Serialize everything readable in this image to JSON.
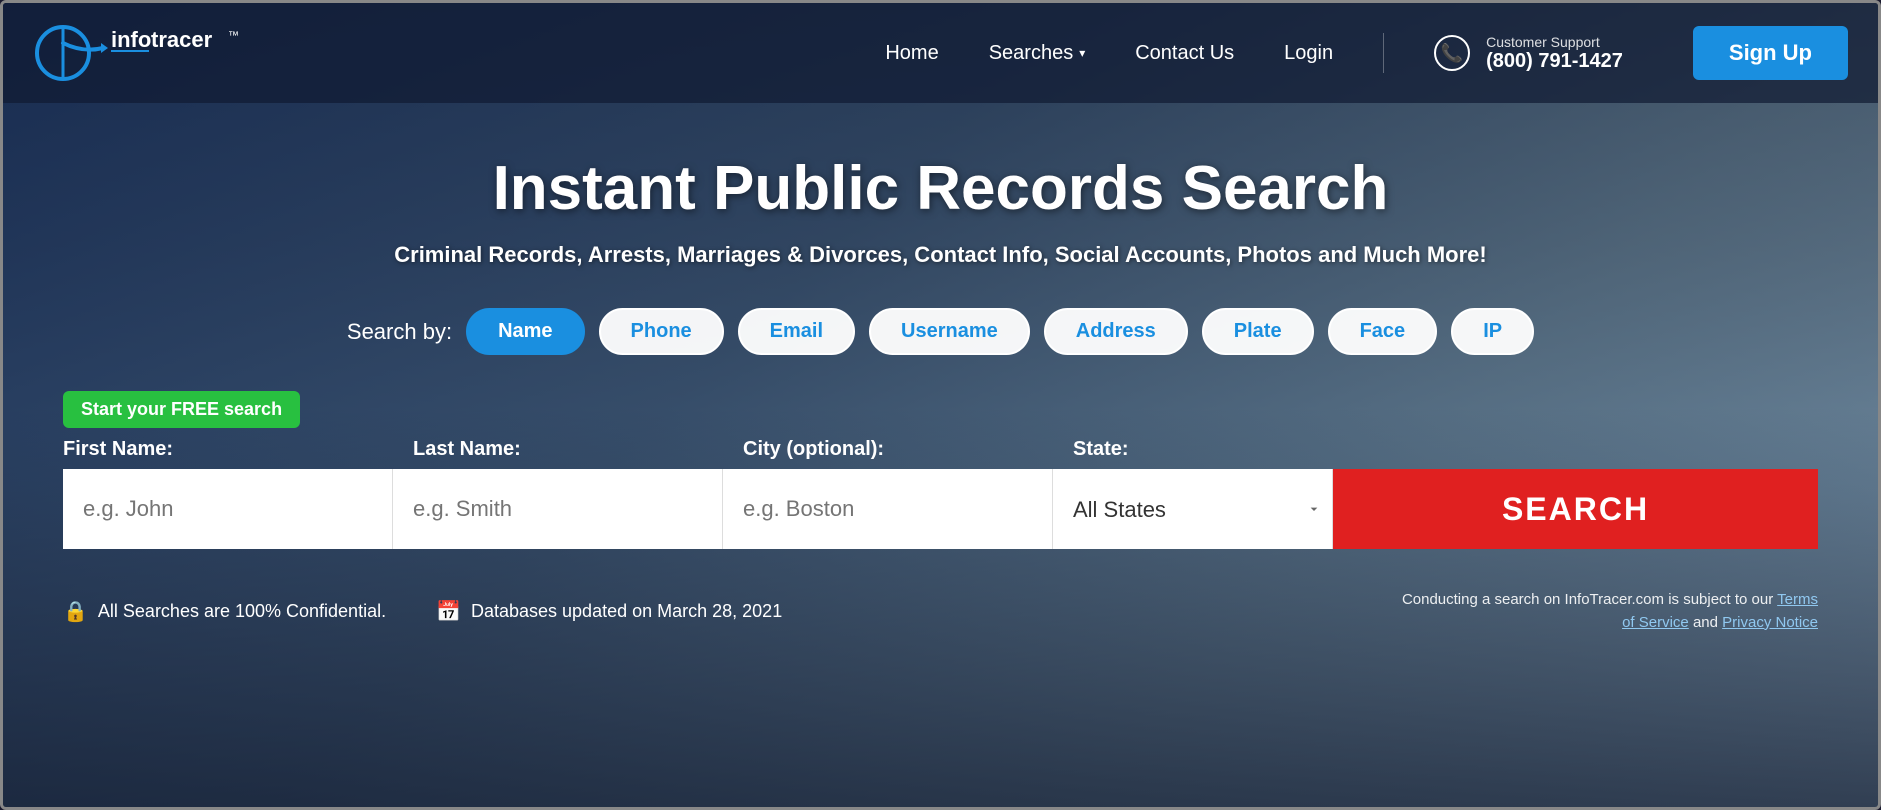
{
  "brand": {
    "logo_text": "info tracer",
    "logo_tm": "™"
  },
  "navbar": {
    "home_label": "Home",
    "searches_label": "Searches",
    "contact_label": "Contact Us",
    "login_label": "Login",
    "support_label": "Customer Support",
    "support_number": "(800) 791-1427",
    "signup_label": "Sign Up"
  },
  "hero": {
    "title": "Instant Public Records Search",
    "subtitle": "Criminal Records, Arrests, Marriages & Divorces, Contact Info, Social Accounts, Photos and Much More!"
  },
  "search_by": {
    "label": "Search by:",
    "tabs": [
      {
        "id": "name",
        "label": "Name",
        "active": true
      },
      {
        "id": "phone",
        "label": "Phone",
        "active": false
      },
      {
        "id": "email",
        "label": "Email",
        "active": false
      },
      {
        "id": "username",
        "label": "Username",
        "active": false
      },
      {
        "id": "address",
        "label": "Address",
        "active": false
      },
      {
        "id": "plate",
        "label": "Plate",
        "active": false
      },
      {
        "id": "face",
        "label": "Face",
        "active": false
      },
      {
        "id": "ip",
        "label": "IP",
        "active": false
      }
    ]
  },
  "search_form": {
    "badge": "Start your FREE search",
    "fields": {
      "first_name_label": "First Name:",
      "first_name_placeholder": "e.g. John",
      "last_name_label": "Last Name:",
      "last_name_placeholder": "e.g. Smith",
      "city_label": "City (optional):",
      "city_placeholder": "e.g. Boston",
      "state_label": "State:",
      "state_default": "All States"
    },
    "search_button_label": "SEARCH"
  },
  "footer_info": {
    "confidential_text": "All Searches are 100% Confidential.",
    "database_text": "Databases updated on March 28, 2021",
    "terms_text": "Conducting a search on InfoTracer.com is subject to our",
    "terms_of_service": "Terms of Service",
    "and_text": "and",
    "privacy_notice": "Privacy Notice"
  }
}
